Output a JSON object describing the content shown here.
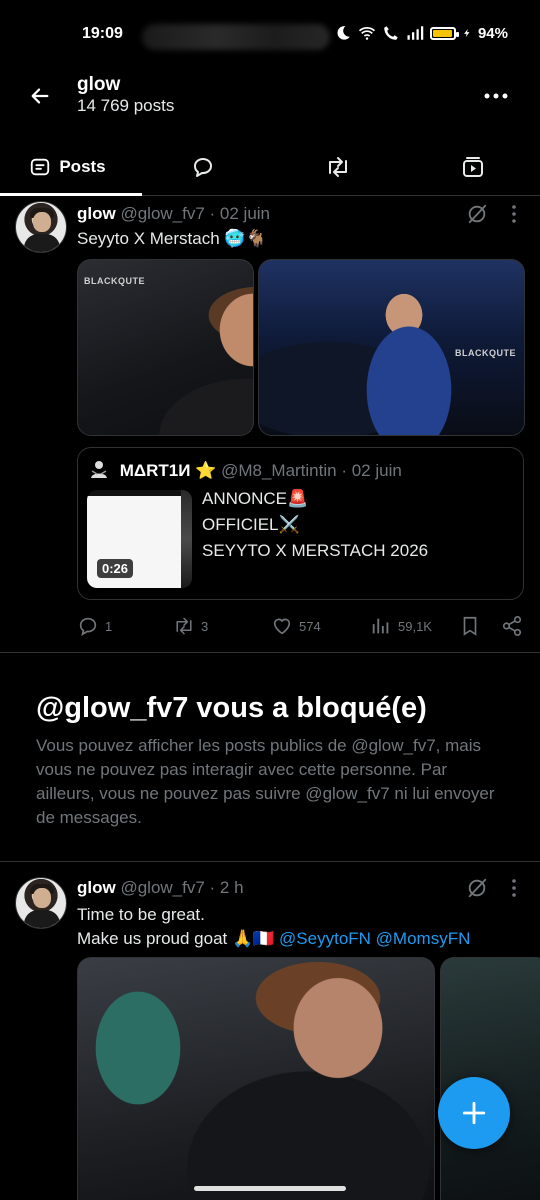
{
  "status_bar": {
    "time": "19:09",
    "battery": "94%",
    "battery_level": 0.94,
    "icons": [
      "moon-icon",
      "wifi-icon",
      "wifi-call-icon",
      "signal-icon",
      "battery-icon",
      "charging-icon"
    ]
  },
  "header": {
    "title": "glow",
    "subtitle": "14 769 posts"
  },
  "tabs": [
    {
      "label": "Posts",
      "icon": "posts-icon",
      "active": true
    },
    {
      "label": "",
      "icon": "replies-icon",
      "active": false
    },
    {
      "label": "",
      "icon": "retweet-icon",
      "active": false
    },
    {
      "label": "",
      "icon": "media-icon",
      "active": false
    }
  ],
  "post1": {
    "name": "glow",
    "handle": "@glow_fv7 · 02 juin",
    "text": "Seyyto X Merstach 🥶🐐",
    "quote": {
      "name": "MΔRT1И ⭐",
      "handle": "@M8_Martintin · 02 juin",
      "duration": "0:26",
      "lines": [
        "ANNONCE🚨",
        "OFFICIEL⚔️",
        "SEYYTO X MERSTACH 2026"
      ]
    },
    "actions": {
      "replies": "1",
      "reposts": "3",
      "likes": "574",
      "views": "59,1K"
    }
  },
  "blocked": {
    "title": "@glow_fv7 vous a bloqué(e)",
    "body": "Vous pouvez afficher les posts publics de @glow_fv7, mais vous ne pouvez pas interagir avec cette personne. Par ailleurs, vous ne pouvez pas suivre @glow_fv7 ni lui envoyer de messages."
  },
  "post2": {
    "name": "glow",
    "handle": "@glow_fv7 · 2 h",
    "line1": "Time to be great.",
    "line2_prefix": "Make us proud goat 🙏🇫🇷 ",
    "mention1": "@SeyytoFN",
    "mention2": "@MomsyFN"
  },
  "colors": {
    "accent": "#1d9bf0",
    "muted": "#71767b",
    "border": "#2f3336"
  }
}
